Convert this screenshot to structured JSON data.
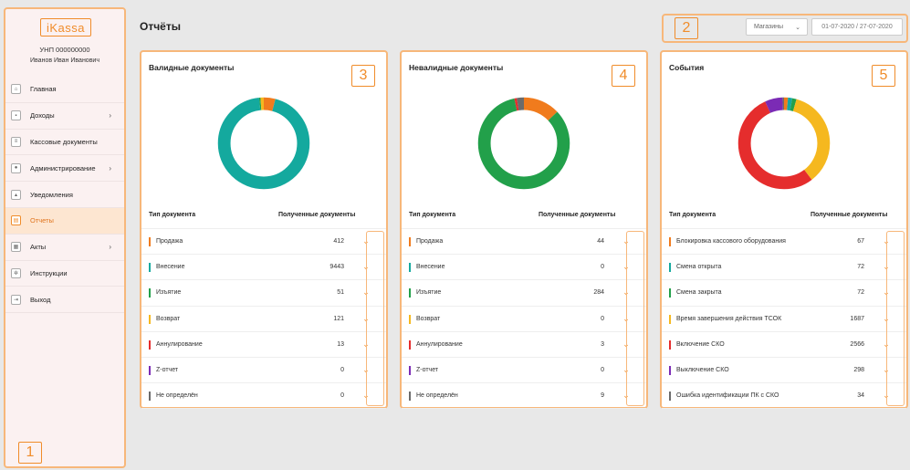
{
  "sidebar": {
    "logo": "iKassa",
    "unp": "УНП 000000000",
    "user": "Иванов Иван Иванович",
    "badge": "1",
    "items": [
      {
        "label": "Главная",
        "icon": "home-icon",
        "glyph": "⌂",
        "has_chevron": false,
        "active": false
      },
      {
        "label": "Доходы",
        "icon": "briefcase-icon",
        "glyph": "▪",
        "has_chevron": true,
        "active": false
      },
      {
        "label": "Кассовые документы",
        "icon": "document-list-icon",
        "glyph": "≡",
        "has_chevron": false,
        "active": false
      },
      {
        "label": "Администрирование",
        "icon": "user-icon",
        "glyph": "●",
        "has_chevron": true,
        "active": false
      },
      {
        "label": "Уведомления",
        "icon": "bell-icon",
        "glyph": "▴",
        "has_chevron": false,
        "active": false
      },
      {
        "label": "Отчеты",
        "icon": "report-icon",
        "glyph": "▤",
        "has_chevron": false,
        "active": true
      },
      {
        "label": "Акты",
        "icon": "acts-icon",
        "glyph": "▦",
        "has_chevron": true,
        "active": false
      },
      {
        "label": "Инструкции",
        "icon": "gear-icon",
        "glyph": "✲",
        "has_chevron": false,
        "active": false
      },
      {
        "label": "Выход",
        "icon": "logout-icon",
        "glyph": "⇥",
        "has_chevron": false,
        "active": false
      }
    ],
    "chevron_glyph": "›"
  },
  "header": {
    "title": "Отчёты",
    "badge": "2",
    "shop_select": "Магазины",
    "date_range": "01-07-2020 / 27-07-2020"
  },
  "cards": [
    {
      "title": "Валидные документы",
      "badge": "3",
      "col_type": "Тип документа",
      "col_count": "Полученные документы",
      "chart_data": {
        "type": "pie",
        "donut": true,
        "categories": [
          "Продажа",
          "Внесение",
          "Изъятие",
          "Возврат",
          "Аннулирование",
          "Z-отчет",
          "Не определён"
        ],
        "values": [
          412,
          9443,
          51,
          121,
          13,
          0,
          0
        ],
        "colors": [
          "#f07b1d",
          "#14a99e",
          "#22a04a",
          "#f5b81f",
          "#e52d2d",
          "#7b2bb5",
          "#6b6b6b"
        ]
      },
      "rows": [
        {
          "name": "Продажа",
          "value": "412",
          "color": "#f07b1d"
        },
        {
          "name": "Внесение",
          "value": "9443",
          "color": "#14a99e"
        },
        {
          "name": "Изъятие",
          "value": "51",
          "color": "#22a04a"
        },
        {
          "name": "Возврат",
          "value": "121",
          "color": "#f5b81f"
        },
        {
          "name": "Аннулирование",
          "value": "13",
          "color": "#e52d2d"
        },
        {
          "name": "Z-отчет",
          "value": "0",
          "color": "#7b2bb5"
        },
        {
          "name": "Не определён",
          "value": "0",
          "color": "#6b6b6b"
        }
      ]
    },
    {
      "title": "Невалидные документы",
      "badge": "4",
      "col_type": "Тип документа",
      "col_count": "Полученные документы",
      "chart_data": {
        "type": "pie",
        "donut": true,
        "categories": [
          "Продажа",
          "Внесение",
          "Изъятие",
          "Возврат",
          "Аннулирование",
          "Z-отчет",
          "Не определён"
        ],
        "values": [
          44,
          0,
          284,
          0,
          3,
          0,
          9
        ],
        "colors": [
          "#f07b1d",
          "#14a99e",
          "#22a04a",
          "#f5b81f",
          "#e52d2d",
          "#7b2bb5",
          "#6b6b6b"
        ]
      },
      "rows": [
        {
          "name": "Продажа",
          "value": "44",
          "color": "#f07b1d"
        },
        {
          "name": "Внесение",
          "value": "0",
          "color": "#14a99e"
        },
        {
          "name": "Изъятие",
          "value": "284",
          "color": "#22a04a"
        },
        {
          "name": "Возврат",
          "value": "0",
          "color": "#f5b81f"
        },
        {
          "name": "Аннулирование",
          "value": "3",
          "color": "#e52d2d"
        },
        {
          "name": "Z-отчет",
          "value": "0",
          "color": "#7b2bb5"
        },
        {
          "name": "Не определён",
          "value": "9",
          "color": "#6b6b6b"
        }
      ]
    },
    {
      "title": "События",
      "badge": "5",
      "col_type": "Тип документа",
      "col_count": "Полученные документы",
      "chart_data": {
        "type": "pie",
        "donut": true,
        "categories": [
          "Блокировка кассового оборудования",
          "Смена открыта",
          "Смена закрыта",
          "Время завершения действия ТСОК",
          "Включение СКО",
          "Выключение СКО",
          "Ошибка идентификации ПК с СКО"
        ],
        "values": [
          67,
          72,
          72,
          1687,
          2566,
          298,
          34
        ],
        "colors": [
          "#f07b1d",
          "#14a99e",
          "#22a04a",
          "#f5b81f",
          "#e52d2d",
          "#7b2bb5",
          "#6b6b6b"
        ]
      },
      "rows": [
        {
          "name": "Блокировка кассового оборудования",
          "value": "67",
          "color": "#f07b1d"
        },
        {
          "name": "Смена открыта",
          "value": "72",
          "color": "#14a99e"
        },
        {
          "name": "Смена закрыта",
          "value": "72",
          "color": "#22a04a"
        },
        {
          "name": "Время завершения действия ТСОК",
          "value": "1687",
          "color": "#f5b81f"
        },
        {
          "name": "Включение СКО",
          "value": "2566",
          "color": "#e52d2d"
        },
        {
          "name": "Выключение СКО",
          "value": "298",
          "color": "#7b2bb5"
        },
        {
          "name": "Ошибка идентификации ПК с СКО",
          "value": "34",
          "color": "#6b6b6b"
        }
      ]
    }
  ],
  "expand_glyph": "⌄"
}
